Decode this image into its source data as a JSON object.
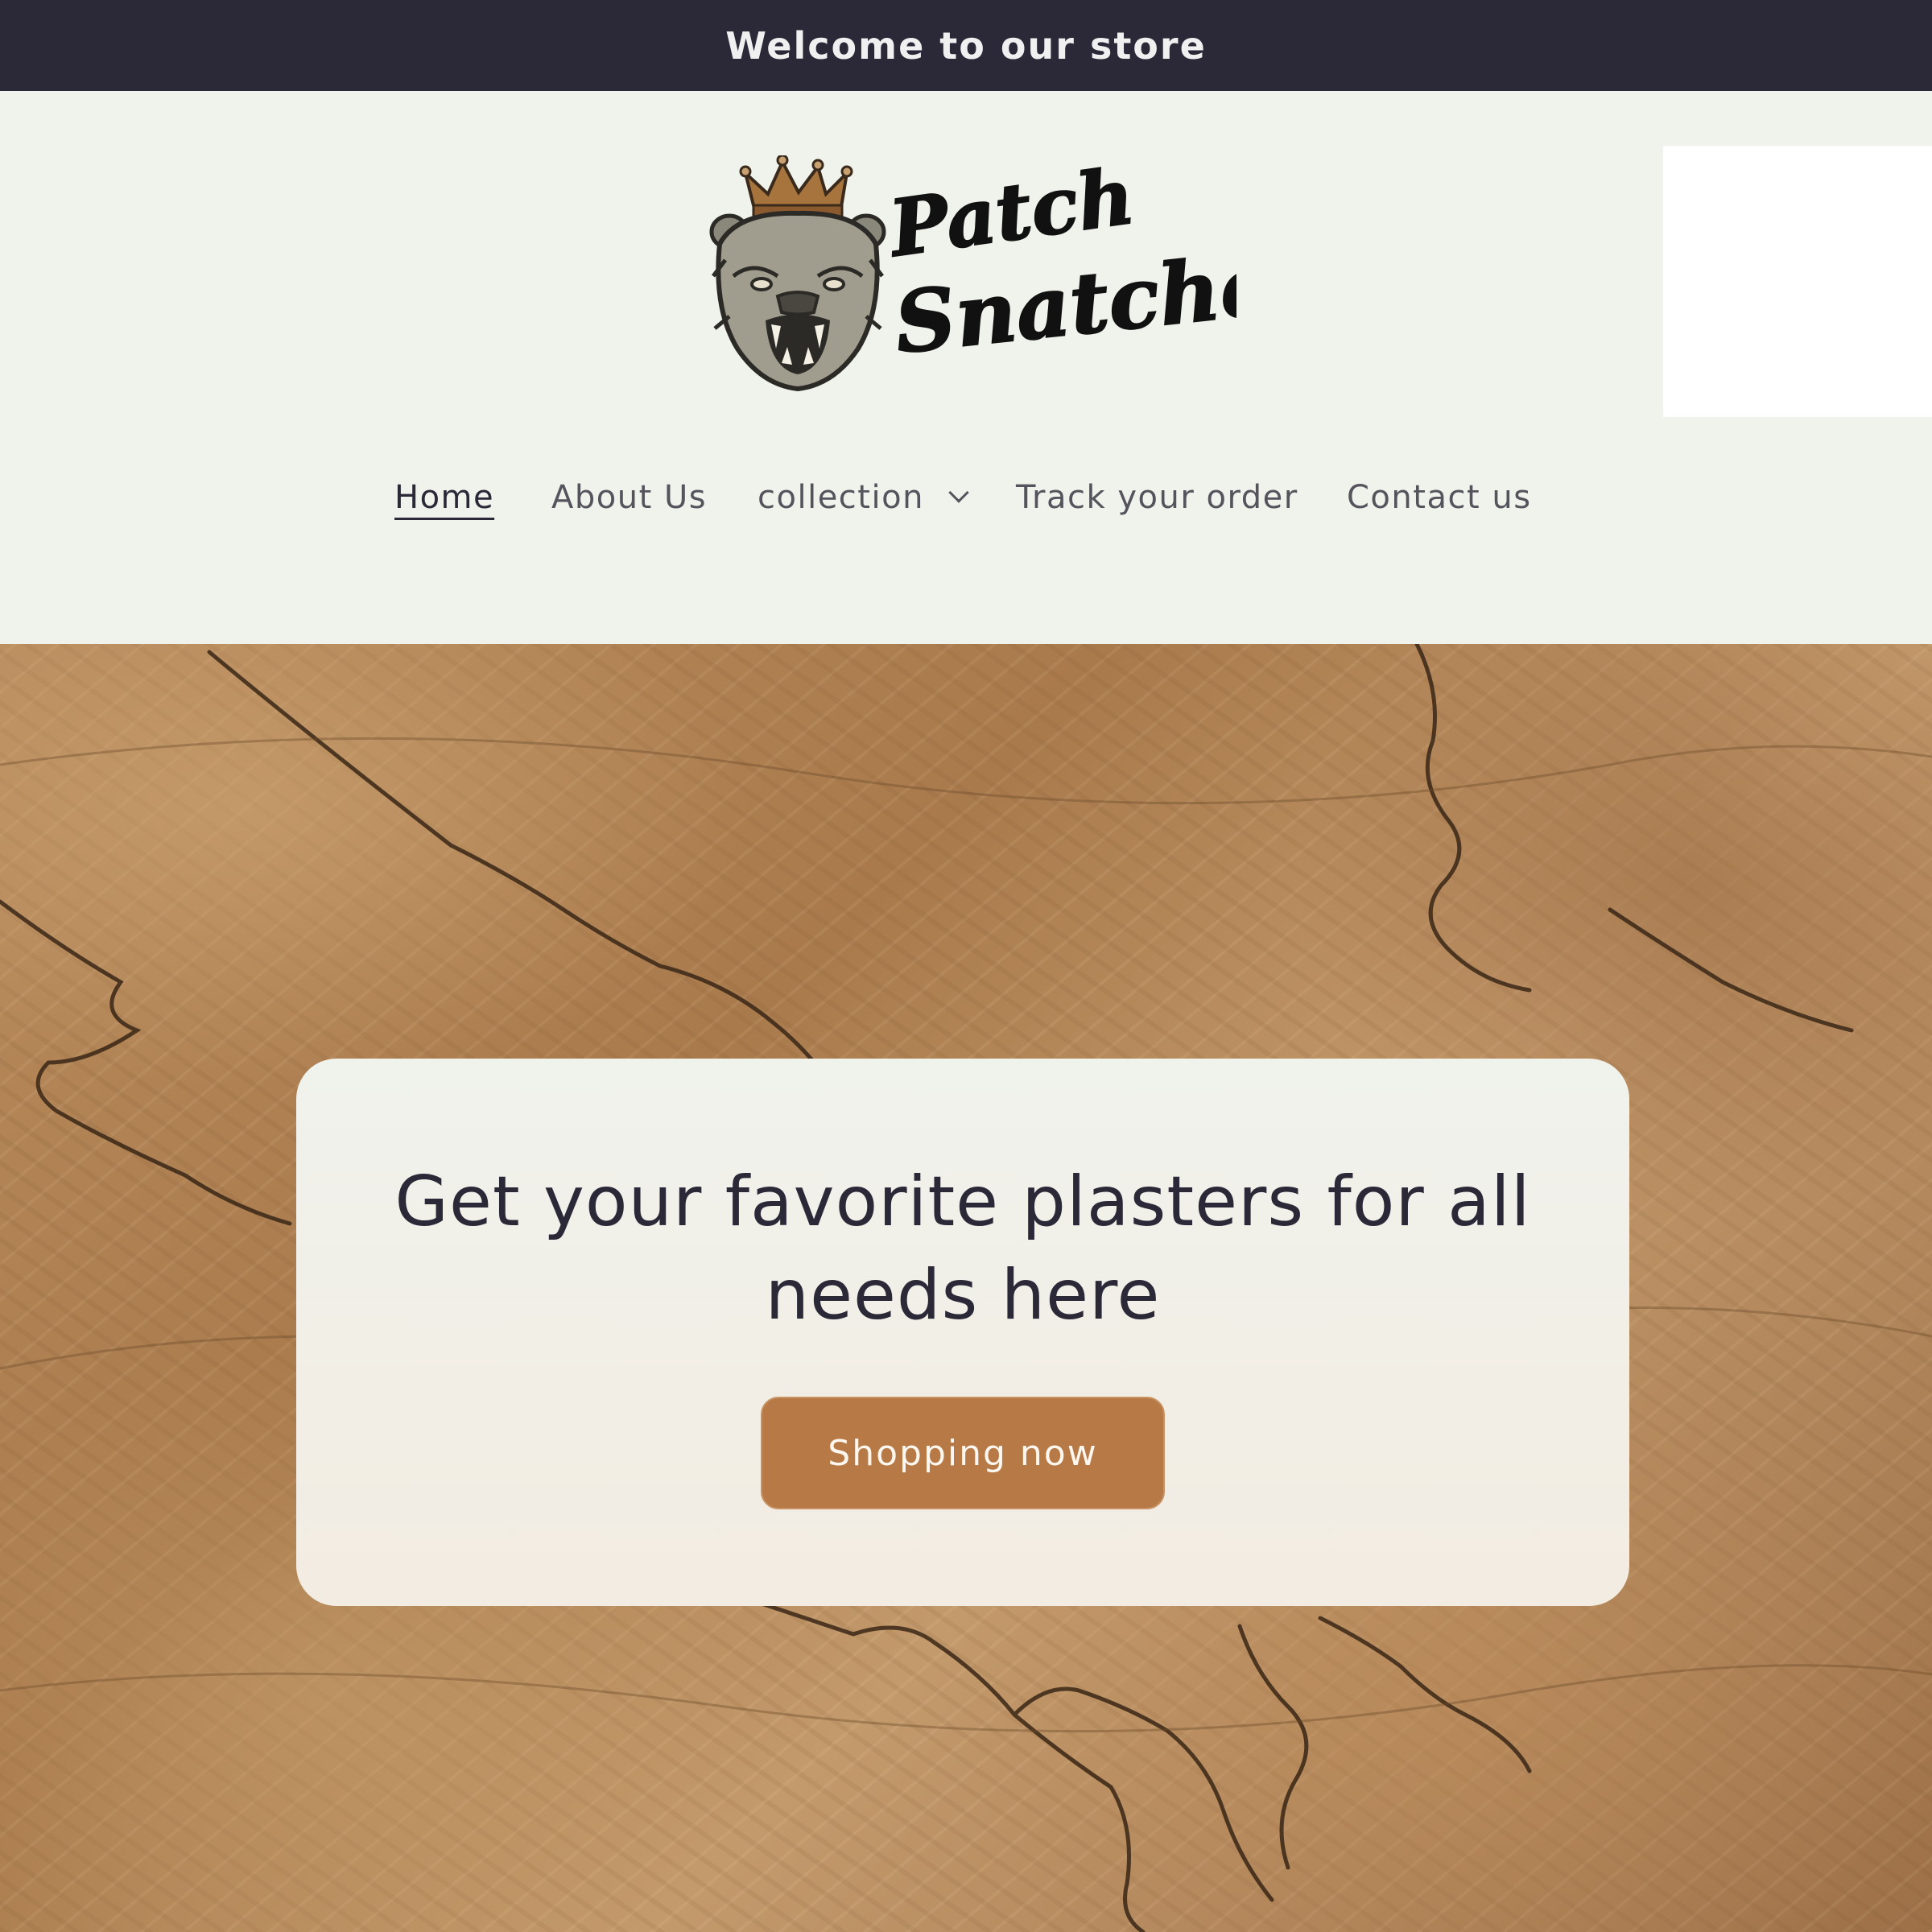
{
  "announcement": {
    "text": "Welcome to our store"
  },
  "header": {
    "logo_text": "Patch Snatched",
    "logo_icon": "crowned-bear-icon"
  },
  "nav": {
    "items": [
      {
        "label": "Home",
        "active": true
      },
      {
        "label": "About Us",
        "active": false
      },
      {
        "label": "collection",
        "active": false,
        "has_dropdown": true
      },
      {
        "label": "Track your order",
        "active": false
      },
      {
        "label": "Contact us",
        "active": false
      }
    ]
  },
  "hero": {
    "heading": "Get your favorite plasters for all needs here",
    "button_label": "Shopping now"
  },
  "colors": {
    "announcement_bg": "#2b2838",
    "header_bg": "#f0f2ec",
    "accent": "#b77a46",
    "text_dark": "#2b2838"
  }
}
